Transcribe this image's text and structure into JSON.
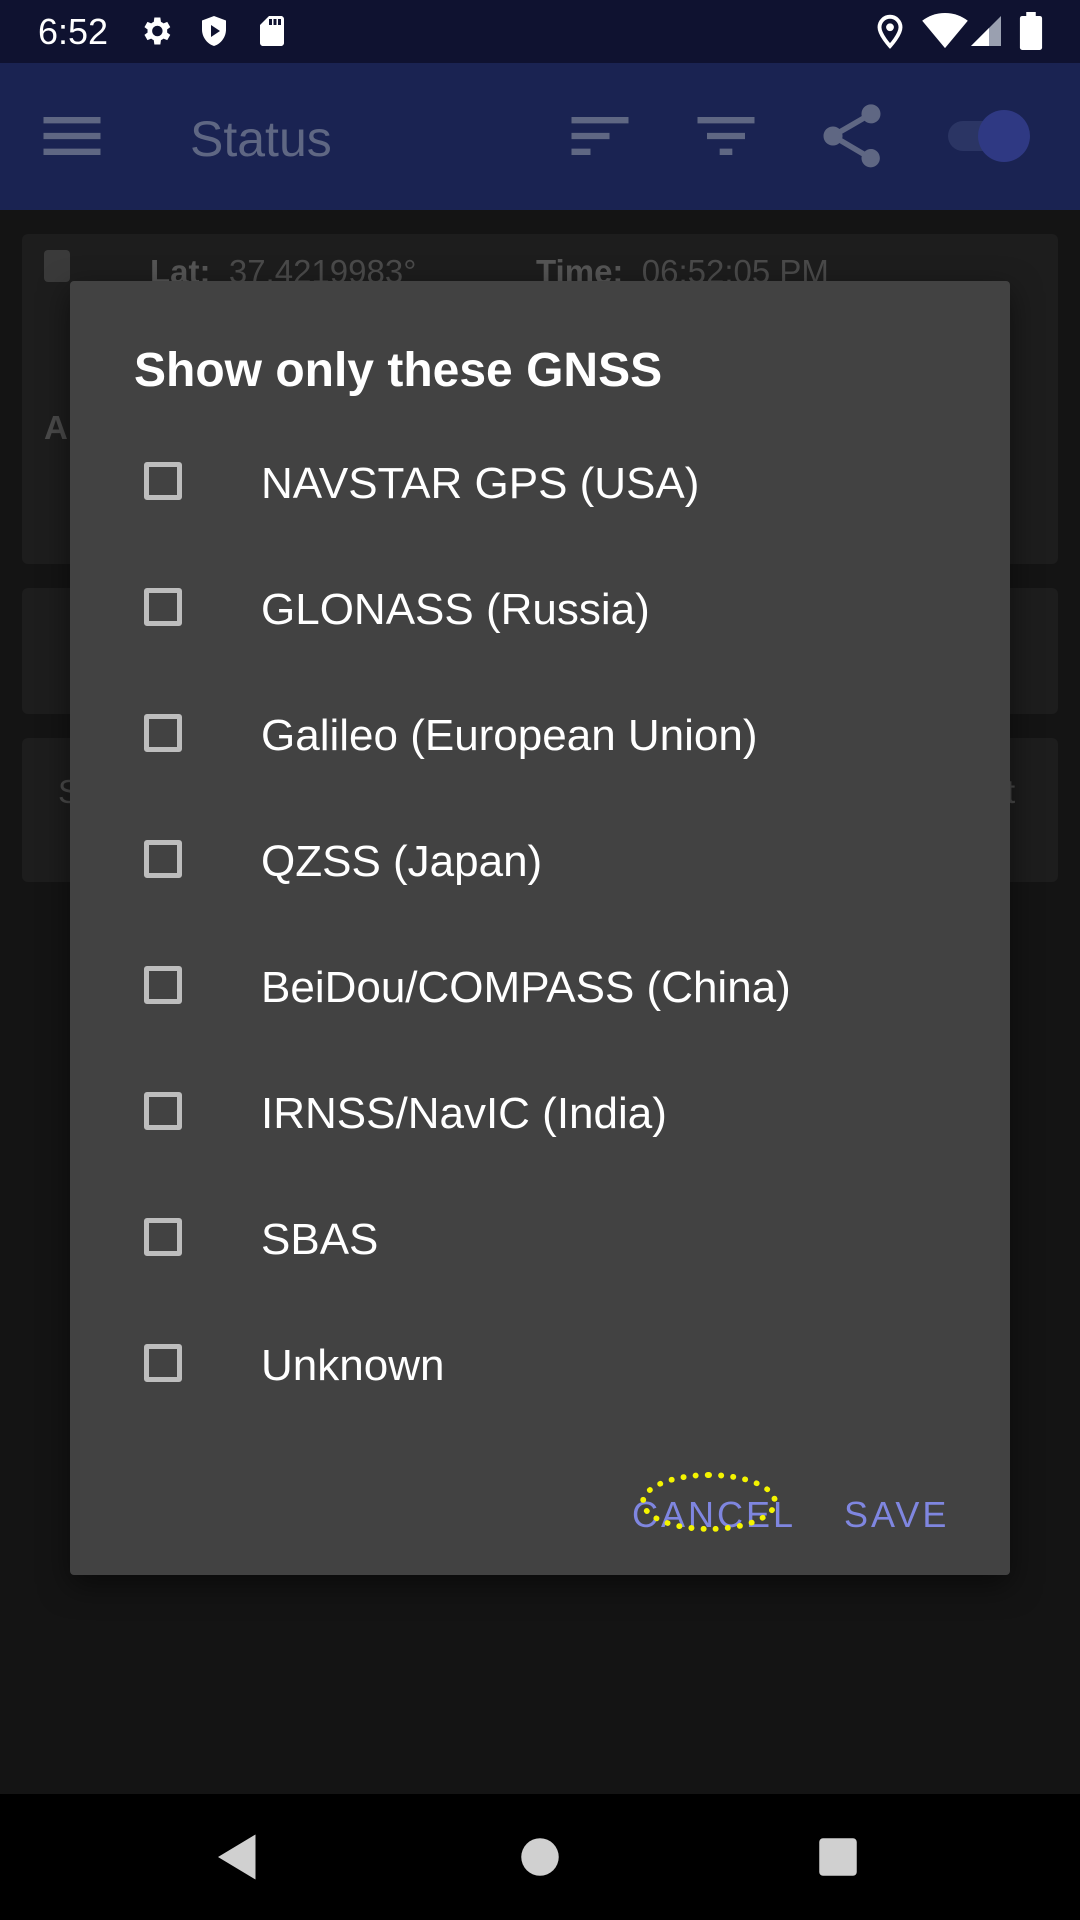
{
  "status_bar": {
    "time": "6:52",
    "icons": [
      "gear-icon",
      "shield-icon",
      "sd-card-icon",
      "location-icon",
      "wifi-icon",
      "signal-icon",
      "battery-icon"
    ]
  },
  "app_bar": {
    "title": "Status",
    "icons": [
      "menu-icon",
      "sort-icon",
      "filter-icon",
      "share-icon"
    ],
    "toggle_on": true
  },
  "background": {
    "lat_label": "Lat:",
    "lat_value": "37.4219983°",
    "time_label": "Time:",
    "time_value": "06:52:05 PM",
    "partial_left_1": "A",
    "partial_left_2": "S",
    "partial_right_2": "t"
  },
  "dialog": {
    "title": "Show only these GNSS",
    "options": [
      {
        "label": "NAVSTAR GPS (USA)",
        "checked": false
      },
      {
        "label": "GLONASS (Russia)",
        "checked": false
      },
      {
        "label": "Galileo (European Union)",
        "checked": false
      },
      {
        "label": "QZSS (Japan)",
        "checked": false
      },
      {
        "label": "BeiDou/COMPASS (China)",
        "checked": false
      },
      {
        "label": "IRNSS/NavIC (India)",
        "checked": false
      },
      {
        "label": "SBAS",
        "checked": false
      },
      {
        "label": "Unknown",
        "checked": false
      }
    ],
    "cancel_label": "CANCEL",
    "save_label": "SAVE"
  },
  "colors": {
    "status_bar": "#0f1230",
    "app_bar": "#1a2352",
    "dialog_bg": "#424242",
    "accent": "#7f86e0",
    "highlight": "#f4f400"
  },
  "nav_bar": {
    "icons": [
      "back-icon",
      "home-icon",
      "recents-icon"
    ]
  }
}
